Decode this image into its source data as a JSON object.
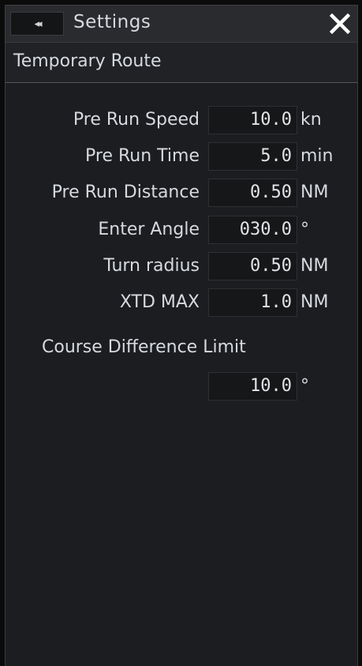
{
  "window": {
    "title": "Settings",
    "collapse_glyph": "◂◂",
    "close_glyph": "✕"
  },
  "section": {
    "title": "Temporary Route"
  },
  "fields": [
    {
      "label": "Pre Run Speed",
      "value": "10.0",
      "unit": "kn"
    },
    {
      "label": "Pre Run Time",
      "value": "5.0",
      "unit": "min"
    },
    {
      "label": "Pre Run Distance",
      "value": "0.50",
      "unit": "NM"
    },
    {
      "label": "Enter Angle",
      "value": "030.0",
      "unit": "°"
    },
    {
      "label": "Turn radius",
      "value": "0.50",
      "unit": "NM"
    },
    {
      "label": "XTD MAX",
      "value": "1.0",
      "unit": "NM"
    }
  ],
  "course_difference": {
    "label": "Course Difference Limit",
    "value": "10.0",
    "unit": "°"
  },
  "colors": {
    "background": "#1c1d20",
    "titlebar": "#2a2b2f",
    "field": "#161719",
    "text": "#d6dadf"
  }
}
